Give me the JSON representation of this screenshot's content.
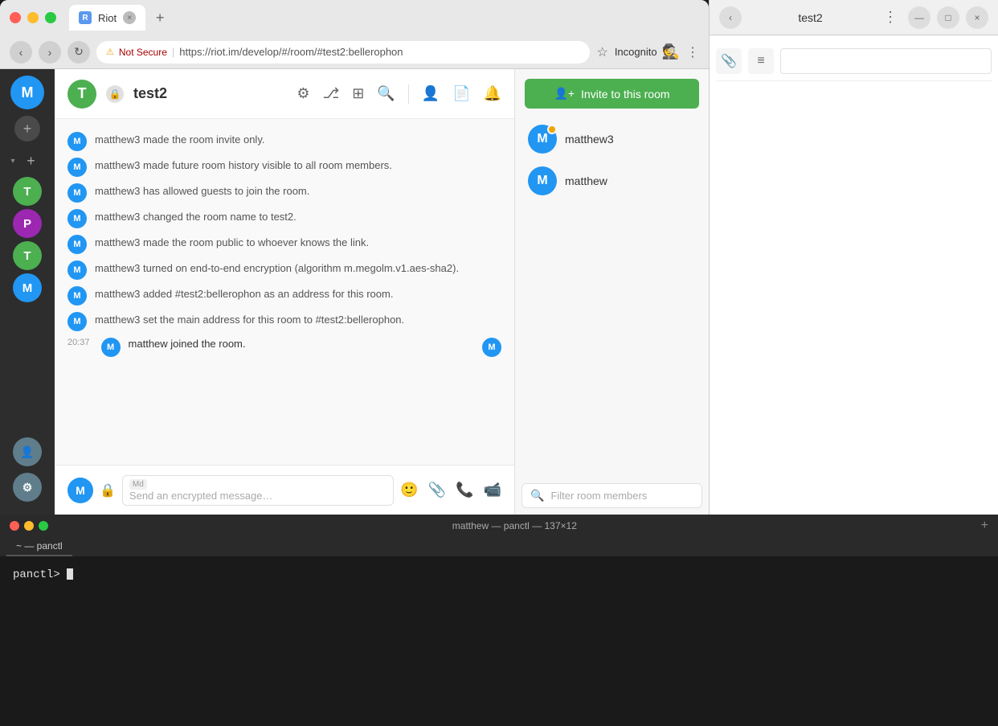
{
  "browser": {
    "tab_title": "Riot",
    "tab_favicon_letter": "R",
    "not_secure_text": "Not Secure",
    "url": "https://riot.im/develop/#/room/#test2:bellerophon",
    "incognito_text": "Incognito"
  },
  "room": {
    "name": "test2",
    "avatar_letter": "T"
  },
  "system_messages": [
    {
      "user": "M",
      "text": "matthew3 made the room invite only."
    },
    {
      "user": "M",
      "text": "matthew3 made future room history visible to all room members."
    },
    {
      "user": "M",
      "text": "matthew3 has allowed guests to join the room."
    },
    {
      "user": "M",
      "text": "matthew3 changed the room name to test2."
    },
    {
      "user": "M",
      "text": "matthew3 made the room public to whoever knows the link."
    },
    {
      "user": "M",
      "text": "matthew3 turned on end-to-end encryption (algorithm m.megolm.v1.aes-sha2)."
    },
    {
      "user": "M",
      "text": "matthew3 added #test2:bellerophon as an address for this room."
    },
    {
      "user": "M",
      "text": "matthew3 set the main address for this room to #test2:bellerophon."
    }
  ],
  "chat_event": {
    "time": "20:37",
    "user_avatar": "M",
    "text": "matthew joined the room.",
    "joined_avatar": "M"
  },
  "chat_input": {
    "placeholder": "Send an encrypted message…",
    "md_label": "Md"
  },
  "right_panel": {
    "invite_button": "Invite to this room",
    "filter_placeholder": "Filter room members",
    "members": [
      {
        "name": "matthew3",
        "avatar_letter": "M",
        "has_badge": true
      },
      {
        "name": "matthew",
        "avatar_letter": "M",
        "has_badge": false
      }
    ]
  },
  "sidebar": {
    "user_avatar_letter": "M",
    "rooms": [
      {
        "letter": "T",
        "color": "#4caf50"
      },
      {
        "letter": "P",
        "color": "#9c27b0"
      },
      {
        "letter": "T",
        "color": "#4caf50"
      },
      {
        "letter": "M",
        "color": "#2196f3"
      }
    ]
  },
  "second_window": {
    "title": "test2"
  },
  "terminal": {
    "title": "matthew — panctl — 137×12",
    "tab_label": "~ — panctl",
    "prompt": "panctl> "
  }
}
